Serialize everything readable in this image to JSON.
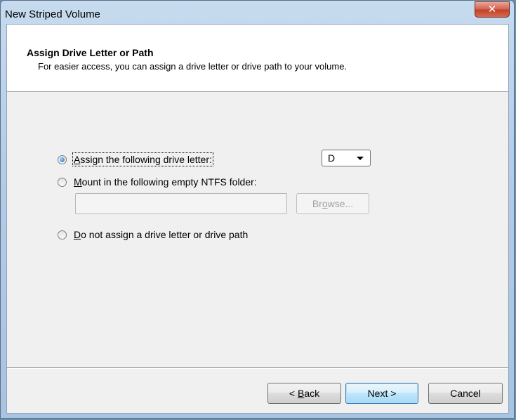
{
  "window": {
    "title": "New Striped Volume"
  },
  "header": {
    "title": "Assign Drive Letter or Path",
    "subtitle": "For easier access, you can assign a drive letter or drive path to your volume."
  },
  "options": {
    "assign_letter": {
      "pre": "",
      "mnemonic": "A",
      "post": "ssign the following drive letter:",
      "checked": true
    },
    "mount_folder": {
      "pre": "",
      "mnemonic": "M",
      "post": "ount in the following empty NTFS folder:",
      "checked": false
    },
    "no_assign": {
      "pre": "",
      "mnemonic": "D",
      "post": "o not assign a drive letter or drive path",
      "checked": false
    }
  },
  "drive_letter": {
    "selected": "D"
  },
  "folder_path": {
    "value": ""
  },
  "browse": {
    "pre": "Br",
    "mnemonic": "o",
    "post": "wse..."
  },
  "buttons": {
    "back": {
      "pre": "< ",
      "mnemonic": "B",
      "post": "ack"
    },
    "next": "Next >",
    "cancel": "Cancel"
  }
}
